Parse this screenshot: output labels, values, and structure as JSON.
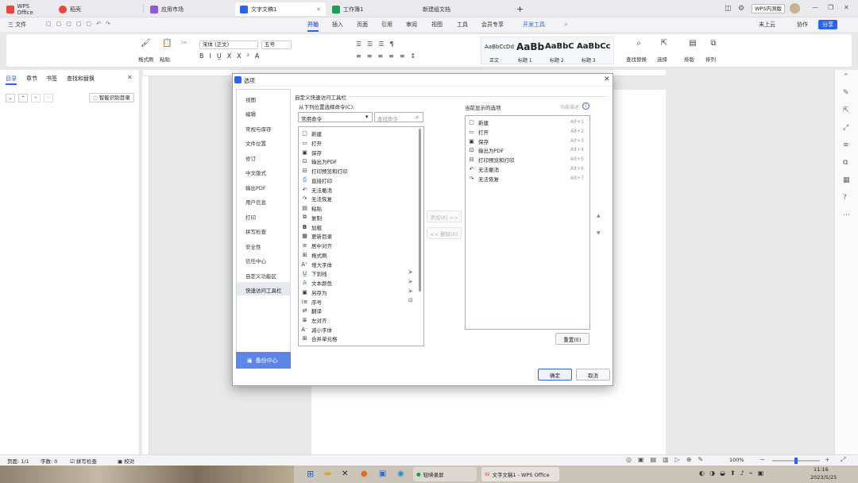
{
  "tabs": {
    "wps_office": "WPS Office",
    "daoke": "稻壳",
    "app_market": "应用市场",
    "doc1": "文字文稿1",
    "sheet1": "工作簿1",
    "new_blank": "新建组文档",
    "plus": "+",
    "wps_internal": "WPS内测版"
  },
  "menubar": {
    "file": "三 文件",
    "items": [
      "开始",
      "插入",
      "页面",
      "引用",
      "审阅",
      "视图",
      "工具",
      "会员专享",
      "开发工具"
    ],
    "cloud": "未上云",
    "collab": "协作",
    "share": "分享"
  },
  "ribbon": {
    "format_painter": "格式刷",
    "paste": "粘贴",
    "font_name": "宋体 (正文)",
    "font_size": "五号",
    "styles": [
      "AaBbCcDd",
      "AaBb",
      "AaBbC",
      "AaBbCc"
    ],
    "style_labels": [
      "正文",
      "标题 1",
      "标题 2",
      "标题 3"
    ],
    "find_replace": "查找替换",
    "select": "选择",
    "layout": "排版",
    "arrange": "排列"
  },
  "left_panel": {
    "tabs": [
      "目录",
      "章节",
      "书签",
      "查找和替换"
    ],
    "smart_toc": "智能识别目录"
  },
  "dialog": {
    "title": "选项",
    "nav": [
      "视图",
      "编辑",
      "常规与保存",
      "文件位置",
      "修订",
      "中文版式",
      "输出PDF",
      "用户信息",
      "打印",
      "拼写检查",
      "安全性",
      "信任中心",
      "自定义功能区",
      "快速访问工具栏"
    ],
    "backup": "备份中心",
    "section_title": "自定义快速访问工具栏",
    "choose_from": "从下列位置选择命令(C):",
    "category": "常用命令",
    "search_placeholder": "查找命令",
    "current_label": "当前显示的选项",
    "func_desc": "功能描述",
    "commands": [
      "新建",
      "打开",
      "保存",
      "输出为PDF",
      "打印预览和打印",
      "直接打印",
      "无法撤消",
      "无法恢复",
      "粘贴",
      "复制",
      "加粗",
      "更新目录",
      "居中对齐",
      "格式刷",
      "增大字体",
      "下划线",
      "文本颜色",
      "另存为",
      "序号",
      "翻译",
      "左对齐",
      "减小字体",
      "合并单元格"
    ],
    "current": [
      {
        "label": "新建",
        "key": "Alt+1"
      },
      {
        "label": "打开",
        "key": "Alt+2"
      },
      {
        "label": "保存",
        "key": "Alt+3"
      },
      {
        "label": "输出为PDF",
        "key": "Alt+4"
      },
      {
        "label": "打印预览和打印",
        "key": "Alt+5"
      },
      {
        "label": "无法撤消",
        "key": "Alt+6"
      },
      {
        "label": "无法恢复",
        "key": "Alt+7"
      }
    ],
    "add": "添加(A) >>",
    "remove": "<< 删除(R)",
    "reset": "重置(E)",
    "ok": "确定",
    "cancel": "取消"
  },
  "statusbar": {
    "page": "页面: 1/1",
    "words": "字数: 0",
    "spell": "拼写检查",
    "proof": "校对",
    "zoom": "100%"
  },
  "taskbar": {
    "recorder": "轻映录屏",
    "wps": "文字文稿1 - WPS Office",
    "time": "11:16",
    "date": "2023/5/25"
  },
  "colors": {
    "accent": "#2b64ee",
    "wps_red": "#e8453c"
  }
}
